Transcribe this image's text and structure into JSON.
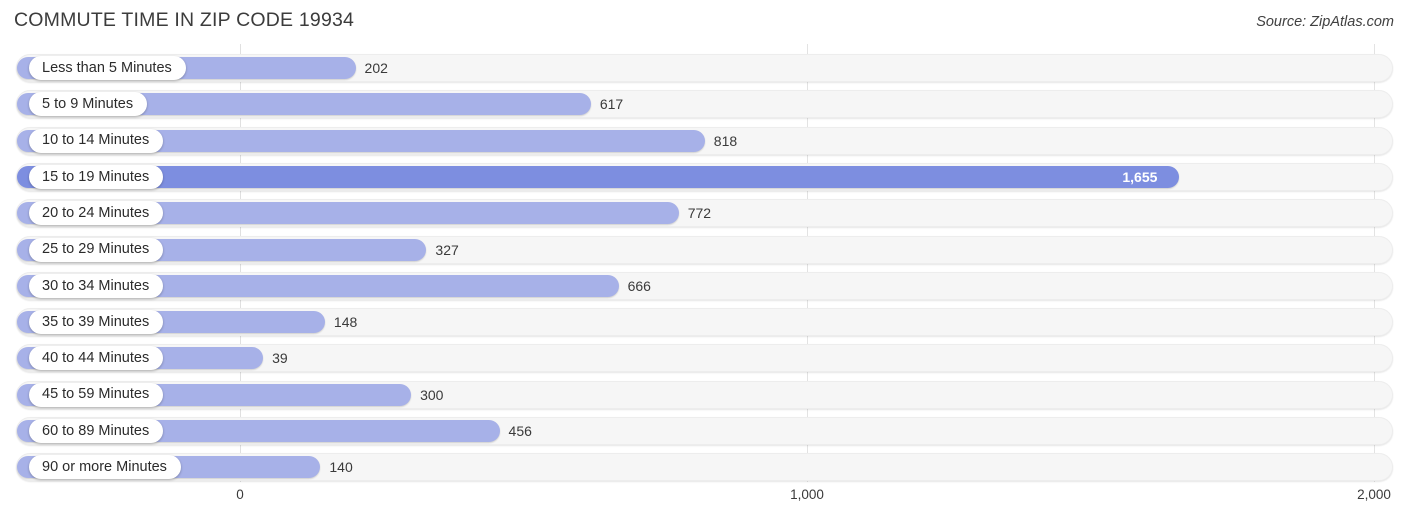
{
  "header": {
    "title": "COMMUTE TIME IN ZIP CODE 19934",
    "source": "Source: ZipAtlas.com"
  },
  "colors": {
    "bar": "#a7b1e8",
    "bar_highlight": "#7d8ee0",
    "track": "#f6f6f6",
    "gridline": "#e3e3e3",
    "text": "#3a3a3a"
  },
  "chart_data": {
    "type": "bar",
    "orientation": "horizontal",
    "title": "COMMUTE TIME IN ZIP CODE 19934",
    "xlabel": "",
    "ylabel": "",
    "xlim": [
      0,
      2000
    ],
    "grid": true,
    "legend": "none",
    "tick_labels": [
      "0",
      "1,000",
      "2,000"
    ],
    "ticks": [
      0,
      1000,
      2000
    ],
    "highlight_index": 3,
    "categories": [
      "Less than 5 Minutes",
      "5 to 9 Minutes",
      "10 to 14 Minutes",
      "15 to 19 Minutes",
      "20 to 24 Minutes",
      "25 to 29 Minutes",
      "30 to 34 Minutes",
      "35 to 39 Minutes",
      "40 to 44 Minutes",
      "45 to 59 Minutes",
      "60 to 89 Minutes",
      "90 or more Minutes"
    ],
    "values": [
      202,
      617,
      818,
      1655,
      772,
      327,
      666,
      148,
      39,
      300,
      456,
      140
    ],
    "value_labels": [
      "202",
      "617",
      "818",
      "1,655",
      "772",
      "327",
      "666",
      "148",
      "39",
      "300",
      "456",
      "140"
    ]
  }
}
